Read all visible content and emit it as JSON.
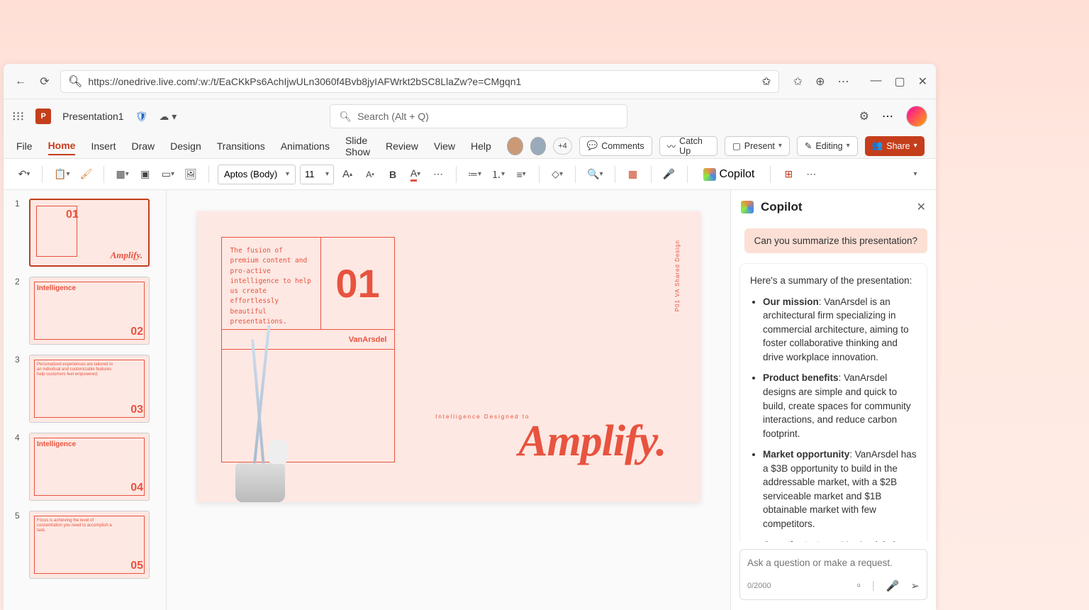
{
  "browser": {
    "url": "https://onedrive.live.com/:w:/t/EaCKkPs6AchIjwULn3060f4Bvb8jyIAFWrkt2bSC8LlaZw?e=CMgqn1"
  },
  "header": {
    "doc_title": "Presentation1",
    "search_placeholder": "Search (Alt + Q)"
  },
  "ribbon": {
    "tabs": [
      "File",
      "Home",
      "Insert",
      "Draw",
      "Design",
      "Transitions",
      "Animations",
      "Slide Show",
      "Review",
      "View",
      "Help"
    ],
    "avatar_overflow": "+4",
    "comments": "Comments",
    "catchup": "Catch Up",
    "present": "Present",
    "editing": "Editing",
    "share": "Share"
  },
  "toolbar": {
    "font": "Aptos (Body)",
    "size": "11",
    "copilot": "Copilot"
  },
  "thumbs": [
    {
      "num": "1",
      "big": "01",
      "title_pos": "br",
      "title": "Amplify."
    },
    {
      "num": "2",
      "big": "02",
      "title_pos": "tl",
      "title": "Intelligence"
    },
    {
      "num": "3",
      "big": "03",
      "title_pos": "body",
      "title": "Personalized experiences are tailored to an individual and customizable features help customers feel empowered."
    },
    {
      "num": "4",
      "big": "04",
      "title_pos": "tl",
      "title": "Intelligence"
    },
    {
      "num": "5",
      "big": "05",
      "title_pos": "body",
      "title": "Focus is achieving the level of concentration you need to accomplish a task."
    }
  ],
  "slide": {
    "text": "The fusion of premium content and pro-active intelligence to help us create effortlessly beautiful presentations.",
    "number": "01",
    "brand": "VanArsdel",
    "subtitle": "Intelligence Designed to",
    "amplify": "Amplify.",
    "side": "P01   VA Shared Design"
  },
  "copilot": {
    "title": "Copilot",
    "user_message": "Can you summarize this presentation?",
    "response_intro": "Here's a summary of the presentation:",
    "bullets": [
      {
        "b": "Our mission",
        "t": ": VanArsdel is an architectural firm specializing in commercial architecture, aiming to foster collaborative thinking and drive workplace innovation."
      },
      {
        "b": "Product benefits",
        "t": ": VanArsdel designs are simple and quick to build, create spaces for community interactions, and reduce carbon footprint."
      },
      {
        "b": "Market opportunity",
        "t": ": VanArsdel has a $3B opportunity to build in the addressable market, with a $2B serviceable market and $1B obtainable market with few competitors."
      },
      {
        "b": "Growth strategy",
        "t": ": VanArsdel plans to roll out drafts to local companies"
      }
    ],
    "input_placeholder": "Ask a question or make a request.",
    "char_count": "0/2000"
  }
}
